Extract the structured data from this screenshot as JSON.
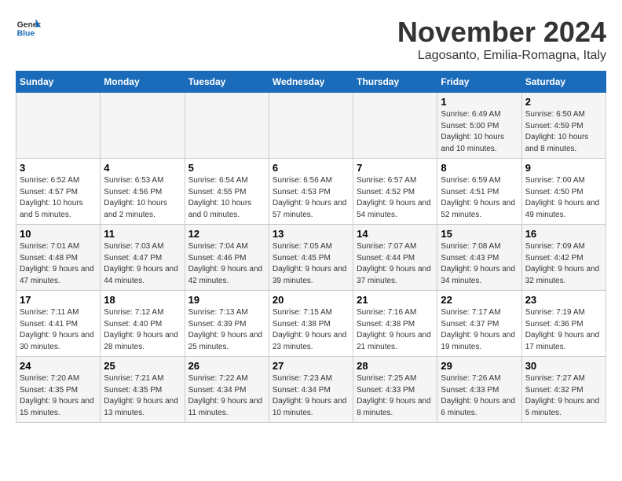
{
  "header": {
    "logo_general": "General",
    "logo_blue": "Blue",
    "month_title": "November 2024",
    "location": "Lagosanto, Emilia-Romagna, Italy"
  },
  "days_of_week": [
    "Sunday",
    "Monday",
    "Tuesday",
    "Wednesday",
    "Thursday",
    "Friday",
    "Saturday"
  ],
  "weeks": [
    [
      {
        "day": "",
        "info": ""
      },
      {
        "day": "",
        "info": ""
      },
      {
        "day": "",
        "info": ""
      },
      {
        "day": "",
        "info": ""
      },
      {
        "day": "",
        "info": ""
      },
      {
        "day": "1",
        "info": "Sunrise: 6:49 AM\nSunset: 5:00 PM\nDaylight: 10 hours and 10 minutes."
      },
      {
        "day": "2",
        "info": "Sunrise: 6:50 AM\nSunset: 4:59 PM\nDaylight: 10 hours and 8 minutes."
      }
    ],
    [
      {
        "day": "3",
        "info": "Sunrise: 6:52 AM\nSunset: 4:57 PM\nDaylight: 10 hours and 5 minutes."
      },
      {
        "day": "4",
        "info": "Sunrise: 6:53 AM\nSunset: 4:56 PM\nDaylight: 10 hours and 2 minutes."
      },
      {
        "day": "5",
        "info": "Sunrise: 6:54 AM\nSunset: 4:55 PM\nDaylight: 10 hours and 0 minutes."
      },
      {
        "day": "6",
        "info": "Sunrise: 6:56 AM\nSunset: 4:53 PM\nDaylight: 9 hours and 57 minutes."
      },
      {
        "day": "7",
        "info": "Sunrise: 6:57 AM\nSunset: 4:52 PM\nDaylight: 9 hours and 54 minutes."
      },
      {
        "day": "8",
        "info": "Sunrise: 6:59 AM\nSunset: 4:51 PM\nDaylight: 9 hours and 52 minutes."
      },
      {
        "day": "9",
        "info": "Sunrise: 7:00 AM\nSunset: 4:50 PM\nDaylight: 9 hours and 49 minutes."
      }
    ],
    [
      {
        "day": "10",
        "info": "Sunrise: 7:01 AM\nSunset: 4:48 PM\nDaylight: 9 hours and 47 minutes."
      },
      {
        "day": "11",
        "info": "Sunrise: 7:03 AM\nSunset: 4:47 PM\nDaylight: 9 hours and 44 minutes."
      },
      {
        "day": "12",
        "info": "Sunrise: 7:04 AM\nSunset: 4:46 PM\nDaylight: 9 hours and 42 minutes."
      },
      {
        "day": "13",
        "info": "Sunrise: 7:05 AM\nSunset: 4:45 PM\nDaylight: 9 hours and 39 minutes."
      },
      {
        "day": "14",
        "info": "Sunrise: 7:07 AM\nSunset: 4:44 PM\nDaylight: 9 hours and 37 minutes."
      },
      {
        "day": "15",
        "info": "Sunrise: 7:08 AM\nSunset: 4:43 PM\nDaylight: 9 hours and 34 minutes."
      },
      {
        "day": "16",
        "info": "Sunrise: 7:09 AM\nSunset: 4:42 PM\nDaylight: 9 hours and 32 minutes."
      }
    ],
    [
      {
        "day": "17",
        "info": "Sunrise: 7:11 AM\nSunset: 4:41 PM\nDaylight: 9 hours and 30 minutes."
      },
      {
        "day": "18",
        "info": "Sunrise: 7:12 AM\nSunset: 4:40 PM\nDaylight: 9 hours and 28 minutes."
      },
      {
        "day": "19",
        "info": "Sunrise: 7:13 AM\nSunset: 4:39 PM\nDaylight: 9 hours and 25 minutes."
      },
      {
        "day": "20",
        "info": "Sunrise: 7:15 AM\nSunset: 4:38 PM\nDaylight: 9 hours and 23 minutes."
      },
      {
        "day": "21",
        "info": "Sunrise: 7:16 AM\nSunset: 4:38 PM\nDaylight: 9 hours and 21 minutes."
      },
      {
        "day": "22",
        "info": "Sunrise: 7:17 AM\nSunset: 4:37 PM\nDaylight: 9 hours and 19 minutes."
      },
      {
        "day": "23",
        "info": "Sunrise: 7:19 AM\nSunset: 4:36 PM\nDaylight: 9 hours and 17 minutes."
      }
    ],
    [
      {
        "day": "24",
        "info": "Sunrise: 7:20 AM\nSunset: 4:35 PM\nDaylight: 9 hours and 15 minutes."
      },
      {
        "day": "25",
        "info": "Sunrise: 7:21 AM\nSunset: 4:35 PM\nDaylight: 9 hours and 13 minutes."
      },
      {
        "day": "26",
        "info": "Sunrise: 7:22 AM\nSunset: 4:34 PM\nDaylight: 9 hours and 11 minutes."
      },
      {
        "day": "27",
        "info": "Sunrise: 7:23 AM\nSunset: 4:34 PM\nDaylight: 9 hours and 10 minutes."
      },
      {
        "day": "28",
        "info": "Sunrise: 7:25 AM\nSunset: 4:33 PM\nDaylight: 9 hours and 8 minutes."
      },
      {
        "day": "29",
        "info": "Sunrise: 7:26 AM\nSunset: 4:33 PM\nDaylight: 9 hours and 6 minutes."
      },
      {
        "day": "30",
        "info": "Sunrise: 7:27 AM\nSunset: 4:32 PM\nDaylight: 9 hours and 5 minutes."
      }
    ]
  ]
}
